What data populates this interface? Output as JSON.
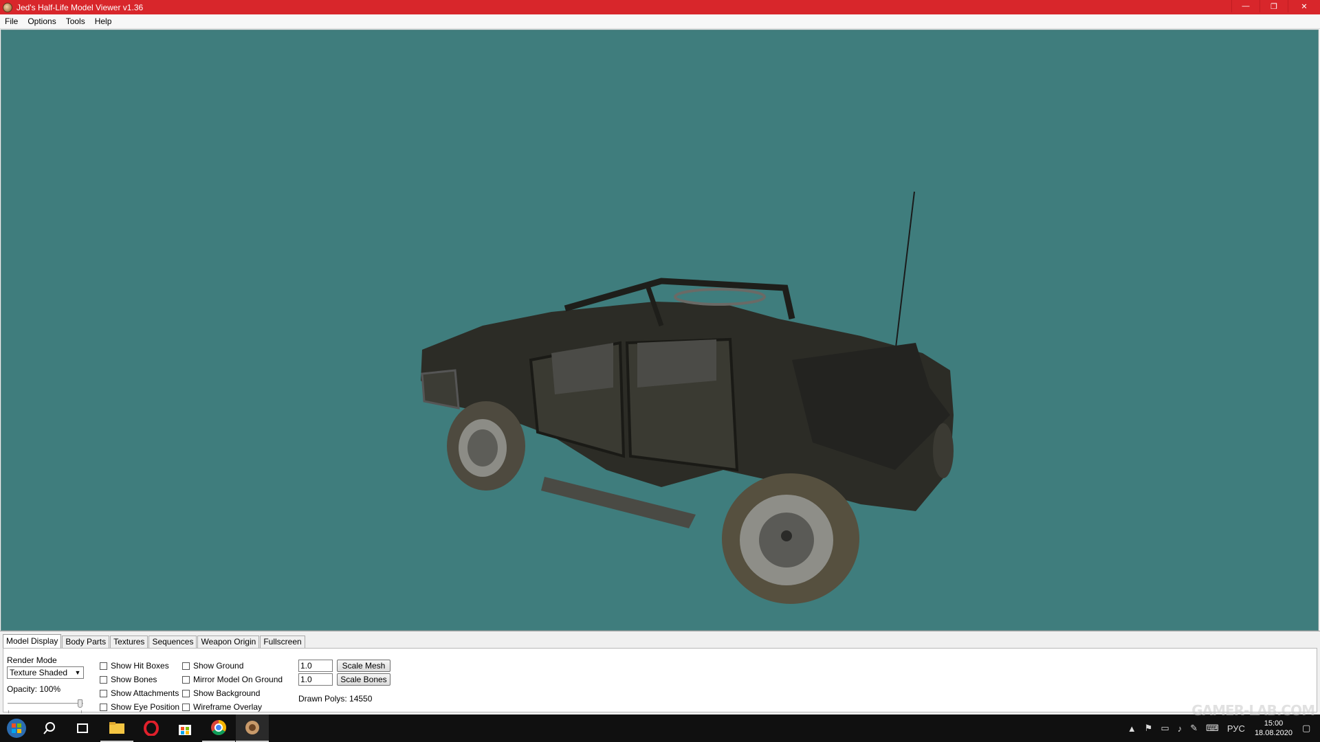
{
  "window": {
    "title": "Jed's Half-Life Model Viewer v1.36",
    "controls": {
      "minimize": "—",
      "maximize": "❐",
      "close": "✕"
    }
  },
  "menu": [
    "File",
    "Options",
    "Tools",
    "Help"
  ],
  "viewport": {
    "background_color": "#3f7d7d",
    "content": "3d-jeep-model"
  },
  "tabs": [
    "Model Display",
    "Body Parts",
    "Textures",
    "Sequences",
    "Weapon Origin",
    "Fullscreen"
  ],
  "model_display": {
    "render_mode_label": "Render Mode",
    "render_mode_value": "Texture Shaded",
    "opacity_label": "Opacity: 100%",
    "opacity_value": 1.0,
    "checkboxes_col1": [
      "Show Hit Boxes",
      "Show Bones",
      "Show Attachments",
      "Show Eye Position"
    ],
    "checkboxes_col2": [
      "Show Ground",
      "Mirror Model On Ground",
      "Show Background",
      "Wireframe Overlay"
    ],
    "scale_mesh_value": "1.0",
    "scale_bones_value": "1.0",
    "scale_mesh_button": "Scale Mesh",
    "scale_bones_button": "Scale Bones",
    "drawn_polys": "Drawn Polys: 14550"
  },
  "taskbar": {
    "tray": {
      "lang": "РУС",
      "time": "15:00",
      "date": "18.08.2020"
    },
    "watermark": "GAMER-LAB.COM"
  }
}
